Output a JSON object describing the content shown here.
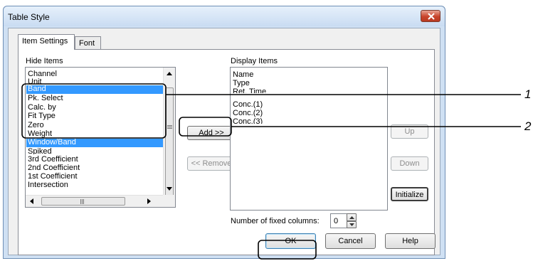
{
  "window": {
    "title": "Table Style"
  },
  "tabs": [
    {
      "label": "Item Settings",
      "active": true
    },
    {
      "label": "Font",
      "active": false
    }
  ],
  "hide_items": {
    "label": "Hide Items",
    "items": [
      "Channel",
      "Unit",
      "Band",
      "Pk. Select",
      "Calc. by",
      "Fit Type",
      "Zero",
      "Weight",
      "Window/Band",
      "Spiked",
      "3rd Coefficient",
      "2nd Coefficient",
      "1st Coefficient",
      "Intersection"
    ],
    "selected": [
      "Band",
      "Window/Band"
    ]
  },
  "display_items": {
    "label": "Display Items",
    "items": [
      "Name",
      "Type",
      "Ret. Time",
      "Conc.(1)",
      "Conc.(2)",
      "Conc.(3)"
    ]
  },
  "buttons": {
    "add": "Add >>",
    "remove": "<< Remove",
    "up": "Up",
    "down": "Down",
    "initialize": "Initialize",
    "ok": "OK",
    "cancel": "Cancel",
    "help": "Help"
  },
  "fixed_columns": {
    "label": "Number of fixed columns:",
    "value": "0"
  },
  "callouts": [
    "1",
    "2"
  ],
  "colors": {
    "selection": "#3399ff",
    "callout_line": "#000000",
    "close_button": "#c8452c"
  }
}
